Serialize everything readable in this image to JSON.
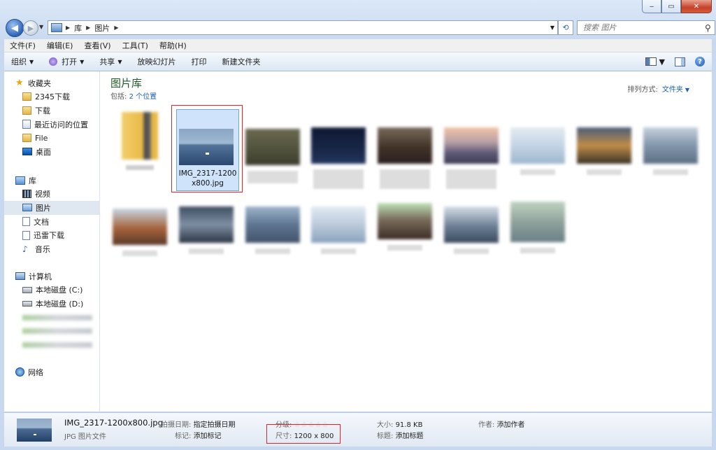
{
  "window": {
    "caption": {
      "minimize": "‒",
      "maximize": "▭",
      "close": "✕"
    }
  },
  "nav": {
    "back_glyph": "◀",
    "forward_glyph": "▶",
    "breadcrumb": [
      "库",
      "图片"
    ],
    "search_placeholder": "搜索 图片"
  },
  "menu": [
    "文件(F)",
    "编辑(E)",
    "查看(V)",
    "工具(T)",
    "帮助(H)"
  ],
  "toolbar": {
    "organize": "组织",
    "open": "打开",
    "share": "共享",
    "slideshow": "放映幻灯片",
    "print": "打印",
    "new_folder": "新建文件夹"
  },
  "sidebar": {
    "favorites": {
      "label": "收藏夹",
      "items": [
        "2345下载",
        "下载",
        "最近访问的位置",
        "File",
        "桌面"
      ]
    },
    "libraries": {
      "label": "库",
      "items": [
        "视频",
        "图片",
        "文档",
        "迅雷下载",
        "音乐"
      ],
      "selected": "图片"
    },
    "computer": {
      "label": "计算机",
      "items": [
        "本地磁盘 (C:)",
        "本地磁盘 (D:)"
      ]
    },
    "network": {
      "label": "网络"
    }
  },
  "content": {
    "title": "图片库",
    "includes_prefix": "包括:",
    "includes_link": "2 个位置",
    "arrange_label": "排列方式:",
    "arrange_value": "文件夹",
    "selected_file": {
      "name_line1": "IMG_2317-1200",
      "name_line2": "x800.jpg"
    }
  },
  "details": {
    "file_name": "IMG_2317-1200x800.jpg",
    "file_type": "JPG 图片文件",
    "date_taken_label": "拍摄日期:",
    "date_taken_value": "指定拍摄日期",
    "tags_label": "标记:",
    "tags_value": "添加标记",
    "rating_label": "分级:",
    "rating_stars": "☆☆☆☆☆",
    "dimensions_label": "尺寸:",
    "dimensions_value": "1200 x 800",
    "size_label": "大小:",
    "size_value": "91.8 KB",
    "title_label": "标题:",
    "title_value": "添加标题",
    "author_label": "作者:",
    "author_value": "添加作者"
  },
  "colors": {
    "highlight_border": "#e0262c",
    "selection": "#cfe3fb",
    "library_title": "#1e5a26",
    "link": "#1f5fb4"
  }
}
